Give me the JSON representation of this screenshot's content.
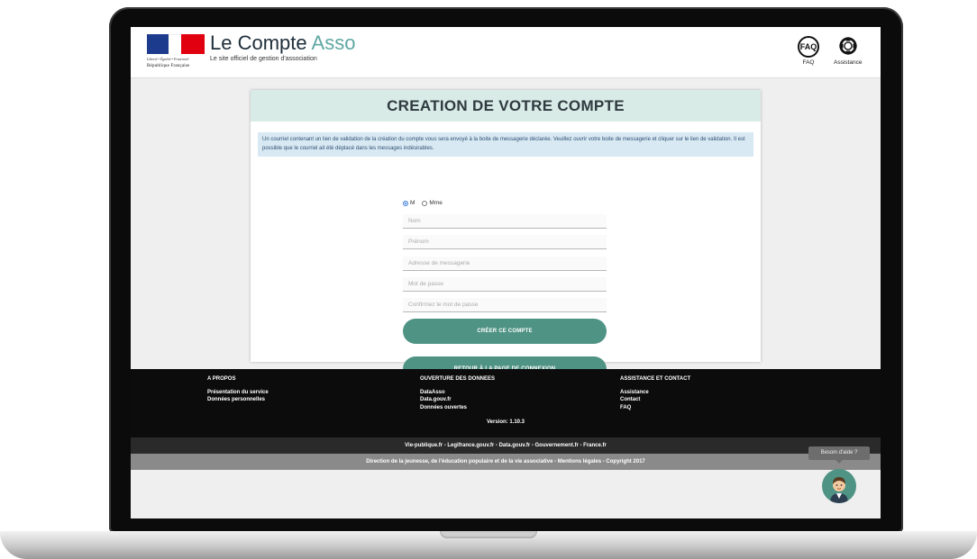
{
  "header": {
    "marianne": {
      "devise": "Liberté • Égalité • Fraternité",
      "republique": "République Française"
    },
    "brand_main": "Le Compte",
    "brand_accent": "Asso",
    "brand_sub": "Le site officiel de gestion d'association",
    "faq_badge": "FAQ",
    "faq_label": "FAQ",
    "assistance_label": "Assistance"
  },
  "card": {
    "title": "CREATION DE VOTRE COMPTE",
    "notice": "Un courriel contenant un lien de validation de la création du compte vous sera envoyé à la boite de messagerie déclarée. Veuillez ouvrir votre boite de messagerie et cliquer sur le lien de validation. Il est possible que le courriel ait été déplacé dans les messages indésirables.",
    "gender": {
      "option_m": "M",
      "option_mme": "Mme",
      "selected": "M"
    },
    "fields": {
      "nom": "Nom",
      "prenom": "Prénom",
      "email": "Adresse de messagerie",
      "password": "Mot de passe",
      "confirm": "Confirmez le mot de passe"
    },
    "create_button": "CRÉER CE COMPTE",
    "back_button": "RETOUR À LA PAGE DE CONNEXION"
  },
  "footer": {
    "col1": {
      "heading": "A PROPOS",
      "links": [
        "Présentation du service",
        "Données personnelles"
      ]
    },
    "col2": {
      "heading": "OUVERTURE DES DONNEES",
      "links": [
        "DataAsso",
        "Data.gouv.fr",
        "Données ouvertes"
      ]
    },
    "col3": {
      "heading": "ASSISTANCE ET CONTACT",
      "links": [
        "Assistance",
        "Contact",
        "FAQ"
      ]
    },
    "version": "Version: 1.10.3",
    "links_bar": "Vie-publique.fr - Legifrance.gouv.fr - Data.gouv.fr - Gouvernement.fr - France.fr",
    "legal_bar": "Direction de la jeunesse, de l'éducation populaire et de la vie associative - Mentions légales - Copyright 2017"
  },
  "help": {
    "tooltip": "Besoin d'aide ?"
  },
  "colors": {
    "accent": "#5ea7a2",
    "button": "#4f9384",
    "card_header": "#d8ebe6",
    "notice_bg": "#d9e9f3"
  }
}
